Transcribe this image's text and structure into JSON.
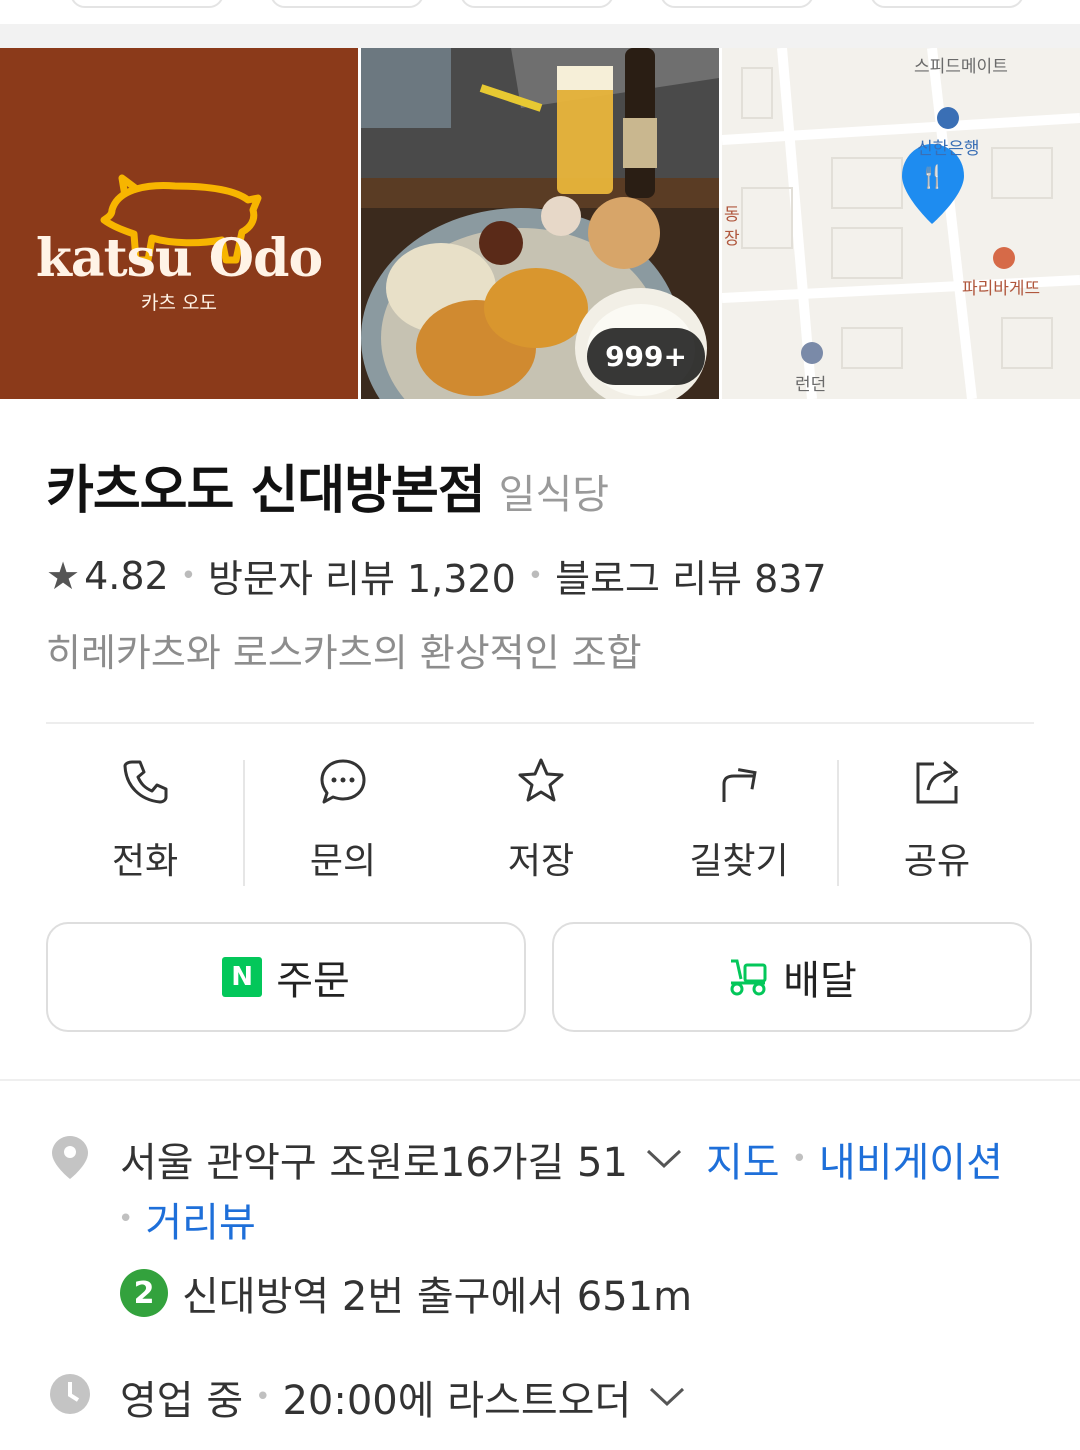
{
  "place": {
    "name": "카츠오도 신대방본점",
    "category": "일식당"
  },
  "photos": {
    "logo_text": "katsu Odo",
    "logo_subtext": "카츠 오도",
    "count_badge": "999+",
    "map_labels": {
      "top": "스피드메이트",
      "bank": "신한은행",
      "bakery": "파리바게뜨",
      "london": "런던",
      "left1": "동",
      "left2": "장"
    }
  },
  "stats": {
    "rating": "4.82",
    "visitor_reviews": "방문자 리뷰 1,320",
    "blog_reviews": "블로그 리뷰 837"
  },
  "description": "히레카츠와 로스카츠의 환상적인 조합",
  "actions": [
    {
      "label": "전화",
      "icon": "phone-icon"
    },
    {
      "label": "문의",
      "icon": "chat-icon"
    },
    {
      "label": "저장",
      "icon": "star-icon"
    },
    {
      "label": "길찾기",
      "icon": "directions-icon"
    },
    {
      "label": "공유",
      "icon": "share-icon"
    }
  ],
  "buttons": {
    "order": {
      "label": "주문",
      "badge": "N"
    },
    "delivery": {
      "label": "배달"
    }
  },
  "address": {
    "text": "서울 관악구 조원로16가길 51",
    "map_link": "지도",
    "navigation_link": "내비게이션",
    "street_view_link": "거리뷰"
  },
  "subway": {
    "line": "2",
    "text": "신대방역 2번 출구에서 651m"
  },
  "hours": {
    "status": "영업 중",
    "last_order": "20:00에 라스트오더"
  },
  "colors": {
    "brand_green": "#03c75a",
    "link_blue": "#1e6fd9",
    "logo_bg": "#8b3a1a",
    "pin_blue": "#1e8cf0",
    "subway_line2": "#33a23d"
  }
}
